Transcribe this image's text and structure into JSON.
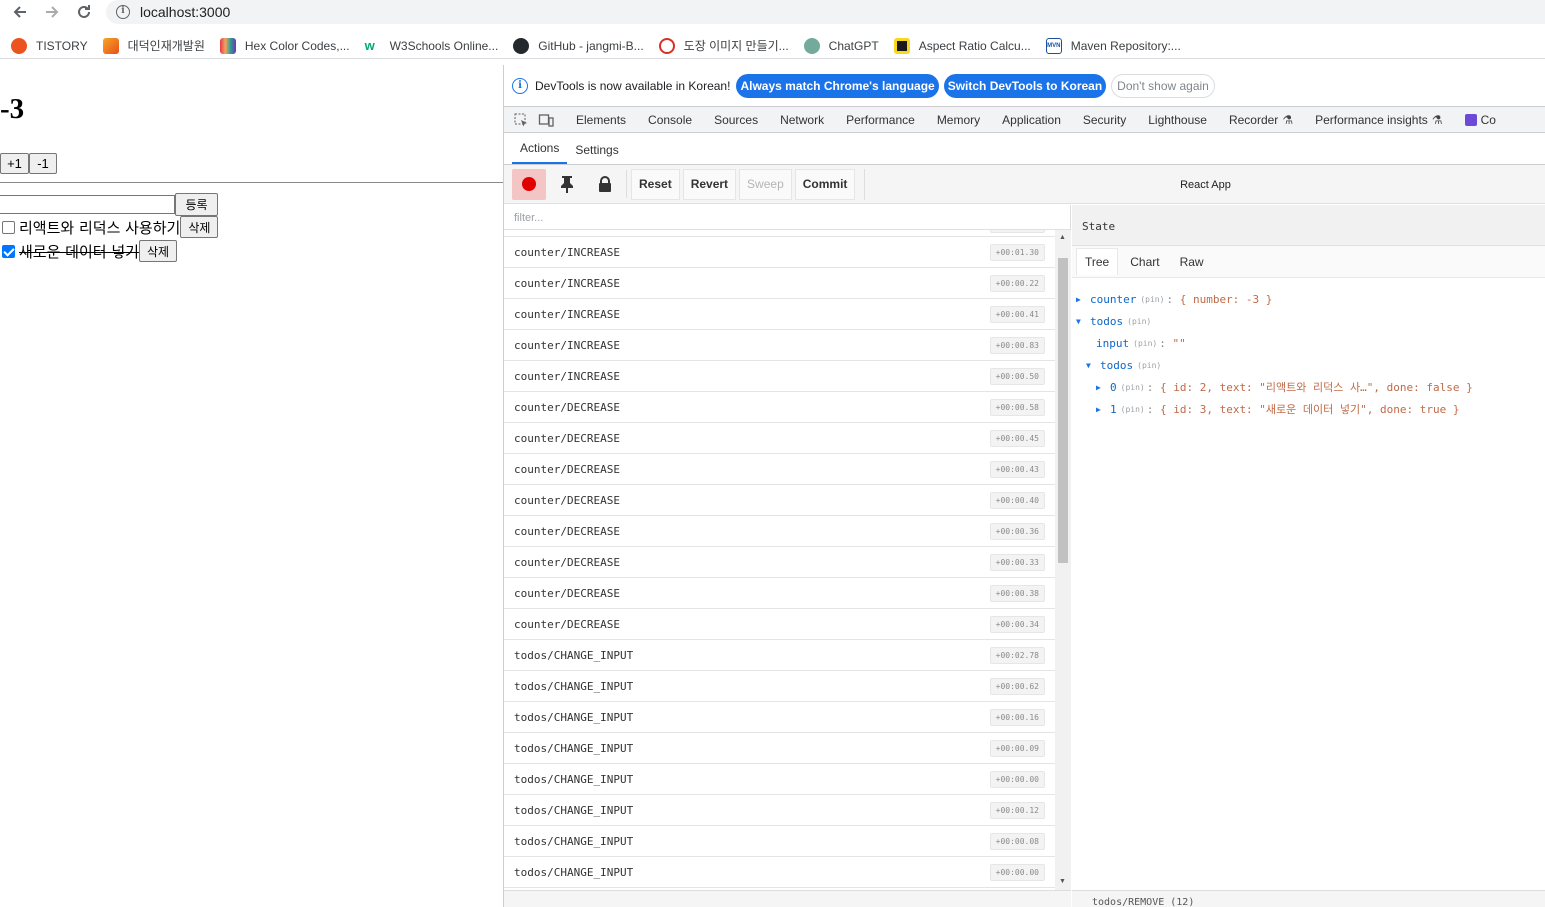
{
  "browser": {
    "url": "localhost:3000",
    "bookmarks": [
      {
        "label": "TISTORY",
        "color": "#eb531f"
      },
      {
        "label": "대덕인재개발원",
        "color": "#f5a623"
      },
      {
        "label": "Hex Color Codes,...",
        "color": "#7b2cbf"
      },
      {
        "label": "W3Schools Online...",
        "color": "#04aa6d"
      },
      {
        "label": "GitHub - jangmi-B...",
        "color": "#24292e"
      },
      {
        "label": "도장 이미지 만들기...",
        "color": "#d93025"
      },
      {
        "label": "ChatGPT",
        "color": "#74aa9c"
      },
      {
        "label": "Aspect Ratio Calcu...",
        "color": "#f9d71c"
      },
      {
        "label": "Maven Repository:...",
        "color": "#1b4f9c"
      }
    ]
  },
  "app": {
    "counter": "-3",
    "increase_label": "+1",
    "decrease_label": "-1",
    "input_value": "",
    "register_label": "등록",
    "todos": [
      {
        "text": "리액트와 리덕스 사용하기",
        "done": false,
        "delete_label": "삭제"
      },
      {
        "text": "새로운 데이터 넣기",
        "done": true,
        "delete_label": "삭제"
      }
    ]
  },
  "devtools": {
    "infobar": {
      "message": "DevTools is now available in Korean!",
      "btn_match": "Always match Chrome's language",
      "btn_switch": "Switch DevTools to Korean",
      "btn_dismiss": "Don't show again"
    },
    "tabs": [
      "Elements",
      "Console",
      "Sources",
      "Network",
      "Performance",
      "Memory",
      "Application",
      "Security",
      "Lighthouse",
      "Recorder",
      "Performance insights",
      "Co"
    ],
    "redux": {
      "tabs": [
        "Actions",
        "Settings"
      ],
      "toolbar": {
        "reset": "Reset",
        "revert": "Revert",
        "sweep": "Sweep",
        "commit": "Commit",
        "instance": "React App"
      },
      "filter_placeholder": "filter...",
      "actions": [
        {
          "type": "counter/INCREASE",
          "time": "+00:01.30"
        },
        {
          "type": "counter/INCREASE",
          "time": "+00:00.22"
        },
        {
          "type": "counter/INCREASE",
          "time": "+00:00.41"
        },
        {
          "type": "counter/INCREASE",
          "time": "+00:00.83"
        },
        {
          "type": "counter/INCREASE",
          "time": "+00:00.50"
        },
        {
          "type": "counter/DECREASE",
          "time": "+00:00.58"
        },
        {
          "type": "counter/DECREASE",
          "time": "+00:00.45"
        },
        {
          "type": "counter/DECREASE",
          "time": "+00:00.43"
        },
        {
          "type": "counter/DECREASE",
          "time": "+00:00.40"
        },
        {
          "type": "counter/DECREASE",
          "time": "+00:00.36"
        },
        {
          "type": "counter/DECREASE",
          "time": "+00:00.33"
        },
        {
          "type": "counter/DECREASE",
          "time": "+00:00.38"
        },
        {
          "type": "counter/DECREASE",
          "time": "+00:00.34"
        },
        {
          "type": "todos/CHANGE_INPUT",
          "time": "+00:02.78"
        },
        {
          "type": "todos/CHANGE_INPUT",
          "time": "+00:00.62"
        },
        {
          "type": "todos/CHANGE_INPUT",
          "time": "+00:00.16"
        },
        {
          "type": "todos/CHANGE_INPUT",
          "time": "+00:00.09"
        },
        {
          "type": "todos/CHANGE_INPUT",
          "time": "+00:00.00"
        },
        {
          "type": "todos/CHANGE_INPUT",
          "time": "+00:00.12"
        },
        {
          "type": "todos/CHANGE_INPUT",
          "time": "+00:00.08"
        },
        {
          "type": "todos/CHANGE_INPUT",
          "time": "+00:00.00"
        }
      ],
      "state_title": "State",
      "state_tabs": [
        "Tree",
        "Chart",
        "Raw"
      ],
      "pin_label": "(pin)",
      "tree": {
        "counter_key": "counter",
        "counter_val": "{ number: -3 }",
        "todos_key": "todos",
        "input_key": "input",
        "input_val": "\"\"",
        "todos_list_key": "todos",
        "item0_key": "0",
        "item0_val": "{ id: 2, text: \"리액트와 리덕스 사…\", done: false }",
        "item1_key": "1",
        "item1_val": "{ id: 3, text: \"새로운 데이터 넣기\", done: true }"
      },
      "bottom_text": "todos/REMOVE (12)"
    }
  }
}
